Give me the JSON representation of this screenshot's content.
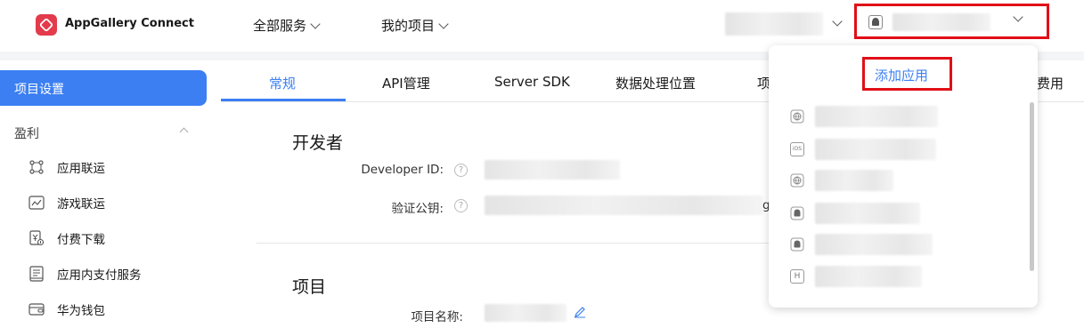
{
  "header": {
    "app_title": "AppGallery Connect",
    "nav": [
      {
        "label": "全部服务"
      },
      {
        "label": "我的项目"
      }
    ],
    "account_label": "",
    "app_selector_label": "",
    "brand_color": "#e33b4c"
  },
  "sidebar": {
    "active_label": "项目设置",
    "group_label": "盈利",
    "items": [
      {
        "label": "应用联运",
        "icon": "network-icon"
      },
      {
        "label": "游戏联运",
        "icon": "chart-line-icon"
      },
      {
        "label": "付费下载",
        "icon": "yuan-download-icon"
      },
      {
        "label": "应用内支付服务",
        "icon": "receipt-icon"
      },
      {
        "label": "华为钱包",
        "icon": "wallet-icon"
      }
    ],
    "accent_color": "#3b7ff2"
  },
  "tabs": [
    {
      "label": "常规",
      "active": true
    },
    {
      "label": "API管理",
      "active": false
    },
    {
      "label": "Server SDK",
      "active": false
    },
    {
      "label": "数据处理位置",
      "active": false
    },
    {
      "label": "项",
      "active": false
    },
    {
      "label": "费用",
      "active": false
    }
  ],
  "developer_section": {
    "title": "开发者",
    "fields": [
      {
        "label": "Developer ID:",
        "value": ""
      },
      {
        "label": "验证公钥:",
        "value": "",
        "value_suffix": "g"
      }
    ]
  },
  "project_section": {
    "title": "项目",
    "fields": [
      {
        "label": "项目名称:",
        "value": ""
      }
    ]
  },
  "dropdown": {
    "add_app_label": "添加应用",
    "apps": [
      {
        "platform": "web-icon"
      },
      {
        "platform": "ios-icon",
        "icon_text": "iOS"
      },
      {
        "platform": "web-icon"
      },
      {
        "platform": "android-icon"
      },
      {
        "platform": "android-icon"
      },
      {
        "platform": "harmony-icon",
        "icon_text": "H"
      }
    ]
  },
  "highlight_color": "#e10f17"
}
